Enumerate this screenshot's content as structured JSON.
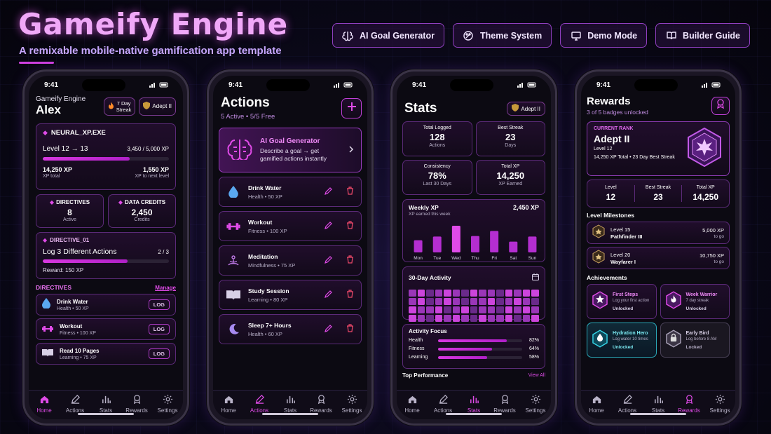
{
  "header": {
    "title": "Gameify Engine",
    "subtitle": "A remixable mobile-native gamification app template",
    "buttons": [
      {
        "label": "AI Goal Generator",
        "icon": "brain-icon"
      },
      {
        "label": "Theme System",
        "icon": "palette-icon"
      },
      {
        "label": "Demo Mode",
        "icon": "monitor-icon"
      },
      {
        "label": "Builder Guide",
        "icon": "book-icon"
      }
    ]
  },
  "status_time": "9:41",
  "tabs": [
    "Home",
    "Actions",
    "Stats",
    "Rewards",
    "Settings"
  ],
  "home": {
    "app_name": "Gameify Engine",
    "user": "Alex",
    "streak_badge": "7 Day Streak",
    "streak_line1": "7 Day",
    "streak_line2": "Streak",
    "rank_badge": "Adept II",
    "xp_card": {
      "label": "NEURAL_XP.EXE",
      "level_text": "Level 12 → 13",
      "xp_progress": "3,450 / 5,000 XP",
      "progress": 0.69,
      "xp_total": "14,250 XP",
      "xp_total_label": "XP total",
      "xp_next": "1,550 XP",
      "xp_next_label": "XP to next level"
    },
    "directives_stat": {
      "label": "DIRECTIVES",
      "value": "8",
      "sub": "Active"
    },
    "credits_stat": {
      "label": "DATA CREDITS",
      "value": "2,450",
      "sub": "Credits"
    },
    "directive": {
      "label": "DIRECTIVE_01",
      "title": "Log 3 Different Actions",
      "count": "2 / 3",
      "progress": 0.67,
      "reward": "Reward: 150 XP"
    },
    "section_title": "DIRECTIVES",
    "manage": "Manage",
    "log_label": "LOG",
    "items": [
      {
        "name": "Drink Water",
        "meta": "Health  •  50 XP",
        "icon": "water-drop-icon"
      },
      {
        "name": "Workout",
        "meta": "Fitness  •  100 XP",
        "icon": "dumbbell-icon"
      },
      {
        "name": "Read 10 Pages",
        "meta": "Learning  •  75 XP",
        "icon": "book-icon"
      }
    ]
  },
  "actions": {
    "title": "Actions",
    "sub_active": "5 Active",
    "sub_free": "5/5 Free",
    "ai_card": {
      "title": "AI Goal Generator",
      "desc": "Describe a goal → get gamified actions instantly"
    },
    "items": [
      {
        "name": "Drink Water",
        "meta": "Health  •  50 XP",
        "icon": "water-drop-icon"
      },
      {
        "name": "Workout",
        "meta": "Fitness  •  100 XP",
        "icon": "dumbbell-icon"
      },
      {
        "name": "Meditation",
        "meta": "Mindfulness  •  75 XP",
        "icon": "meditation-icon"
      },
      {
        "name": "Study Session",
        "meta": "Learning  •  80 XP",
        "icon": "book-icon"
      },
      {
        "name": "Sleep 7+ Hours",
        "meta": "Health  •  60 XP",
        "icon": "moon-icon"
      }
    ]
  },
  "stats": {
    "title": "Stats",
    "rank_badge": "Adept II",
    "cards": [
      {
        "label": "Total Logged",
        "value": "128",
        "sub": "Actions"
      },
      {
        "label": "Best Streak",
        "value": "23",
        "sub": "Days"
      },
      {
        "label": "Consistency",
        "value": "78%",
        "sub": "Last 30 Days"
      },
      {
        "label": "Total XP",
        "value": "14,250",
        "sub": "XP Earned"
      }
    ],
    "weekly": {
      "title": "Weekly XP",
      "sub": "XP earned this week",
      "total": "2,450 XP"
    },
    "activity_title": "30-Day Activity",
    "activity_levels": [
      2,
      3,
      1,
      2,
      3,
      2,
      1,
      3,
      2,
      2,
      1,
      3,
      2,
      3,
      3,
      2,
      3,
      1,
      2,
      3,
      2,
      1,
      2,
      2,
      3,
      1,
      2,
      3,
      2,
      1,
      3,
      2,
      2,
      3,
      1,
      2,
      3,
      1,
      2,
      2,
      1,
      3,
      2,
      3,
      2,
      3,
      2,
      1,
      3,
      2,
      3,
      2,
      1,
      3,
      2,
      2,
      3,
      1,
      2,
      3
    ],
    "focus_title": "Activity Focus",
    "focus": [
      {
        "label": "Health",
        "value": "82%",
        "pct": 0.82
      },
      {
        "label": "Fitness",
        "value": "64%",
        "pct": 0.64
      },
      {
        "label": "Learning",
        "value": "58%",
        "pct": 0.58
      }
    ],
    "top_title": "Top Performance",
    "view_all": "View All"
  },
  "chart_data": {
    "type": "bar",
    "title": "Weekly XP",
    "categories": [
      "Mon",
      "Tue",
      "Wed",
      "Thu",
      "Fri",
      "Sat",
      "Sun"
    ],
    "values": [
      260,
      340,
      570,
      350,
      460,
      230,
      340
    ],
    "ylim": [
      0,
      600
    ],
    "grid": false
  },
  "rewards": {
    "title": "Rewards",
    "sub": "3 of 5 badges unlocked",
    "rank": {
      "label": "CURRENT RANK",
      "name": "Adept II",
      "level": "Level 12",
      "meta": "14,250 XP Total  •  23 Day Best Streak"
    },
    "stats": [
      {
        "label": "Level",
        "value": "12"
      },
      {
        "label": "Best Streak",
        "value": "23"
      },
      {
        "label": "Total XP",
        "value": "14,250"
      }
    ],
    "milestones_title": "Level Milestones",
    "milestones": [
      {
        "level": "Level 15",
        "name": "Pathfinder III",
        "xp": "5,000 XP",
        "togo": "to go"
      },
      {
        "level": "Level 20",
        "name": "Wayfarer I",
        "xp": "10,750 XP",
        "togo": "to go"
      }
    ],
    "achievements_title": "Achievements",
    "achievements": [
      {
        "name": "First Steps",
        "desc": "Log your first action",
        "state": "Unlocked",
        "icon": "star-icon",
        "color": "#e04be8"
      },
      {
        "name": "Week Warrior",
        "desc": "7 day streak",
        "state": "Unlocked",
        "icon": "flame-icon",
        "color": "#e04be8"
      },
      {
        "name": "Hydration Hero",
        "desc": "Log water 10 times",
        "state": "Unlocked",
        "icon": "water-drop-icon",
        "color": "#35d6e8"
      },
      {
        "name": "Early Bird",
        "desc": "Log before 8 AM",
        "state": "Locked",
        "icon": "lock-icon",
        "color": "#a9a2b8"
      }
    ]
  }
}
